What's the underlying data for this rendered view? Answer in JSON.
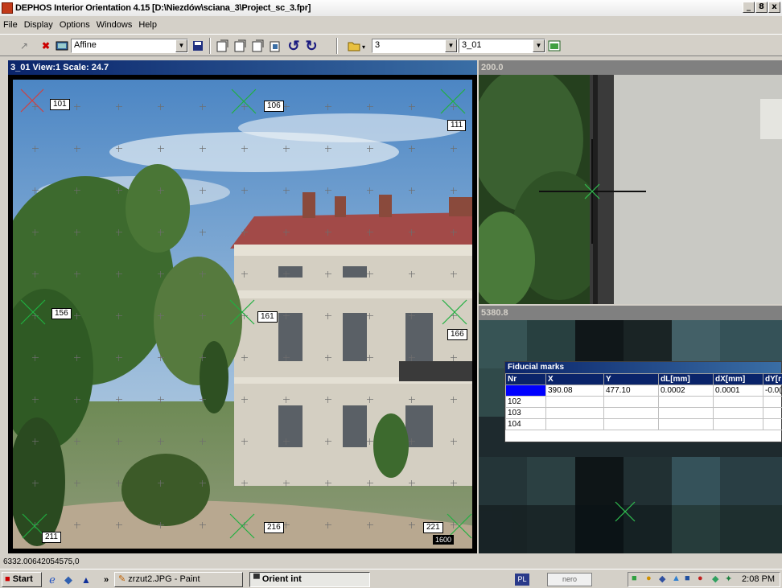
{
  "window": {
    "title": "DEPHOS Interior Orientation 4.15 [D:\\Niezdów\\sciana_3\\Project_sc_3.fpr]",
    "buttons": [
      "_",
      "8",
      "x"
    ]
  },
  "menu": [
    "File",
    "Display",
    "Options",
    "Windows",
    "Help"
  ],
  "toolbar": {
    "transform_select": "Affine",
    "project_num": "3",
    "image_select": "3_01"
  },
  "main_view": {
    "header": "3_01 View:1 Scale:  24.7",
    "marks": [
      {
        "label": "101",
        "color": "#d04040"
      },
      {
        "label": "106",
        "color": "#20b040"
      },
      {
        "label": "111",
        "color": "#20b040"
      },
      {
        "label": "156",
        "color": "#20b040"
      },
      {
        "label": "161",
        "color": "#20b040"
      },
      {
        "label": "166",
        "color": "#20b040"
      },
      {
        "label": "211",
        "color": "#20b040"
      },
      {
        "label": "216",
        "color": "#20b040"
      },
      {
        "label": "221",
        "color": "#20b040"
      }
    ],
    "scale_badge": "1600"
  },
  "zoom_view_top": {
    "header": "200.0"
  },
  "zoom_view_bottom": {
    "header": "5380.8"
  },
  "fiducial_table": {
    "title": "Fiducial marks",
    "columns": [
      "Nr",
      "X",
      "Y",
      "dL[mm]",
      "dX[mm]",
      "dY[r"
    ],
    "rows": [
      [
        "",
        "390.08",
        "477.10",
        "0.0002",
        "0.0001",
        "-0.0("
      ],
      [
        "102",
        "",
        "",
        "",
        "",
        ""
      ],
      [
        "103",
        "",
        "",
        "",
        "",
        ""
      ],
      [
        "104",
        "",
        "",
        "",
        "",
        ""
      ]
    ]
  },
  "status_text": "6332.00642054575,0",
  "taskbar": {
    "start": "Start",
    "tasks": [
      "zrzut2.JPG - Paint",
      "Orient int"
    ],
    "tray_badge": "PL",
    "nero": "nero",
    "clock": "2:08 PM"
  }
}
